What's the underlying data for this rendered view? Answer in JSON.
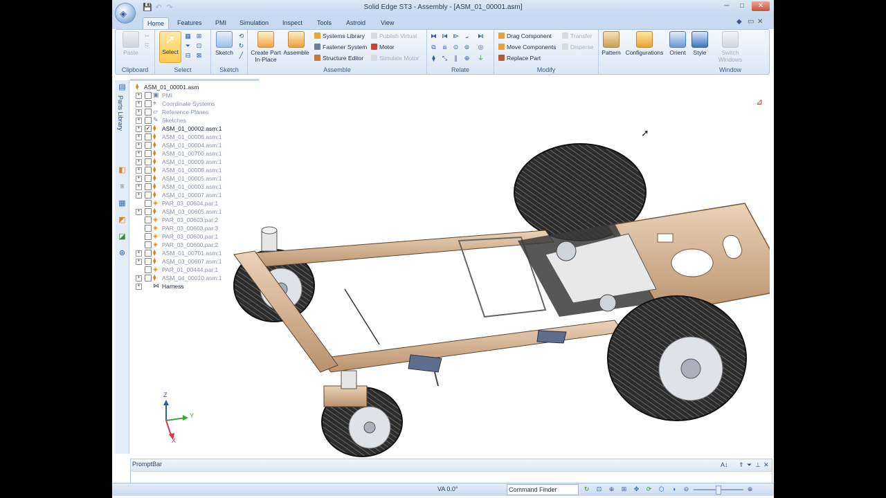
{
  "app": {
    "title": "Solid Edge ST3 - Assembly - [ASM_01_00001.asm]"
  },
  "tabs": [
    "Home",
    "Features",
    "PMI",
    "Simulation",
    "Inspect",
    "Tools",
    "Astroid",
    "View"
  ],
  "ribbon": {
    "clipboard": {
      "paste": "Paste",
      "group": "Clipboard"
    },
    "select": {
      "select": "Select",
      "group": "Select"
    },
    "sketch": {
      "sketch": "Sketch",
      "group": "Sketch"
    },
    "assemble": {
      "create_part": "Create Part In-Place",
      "create_part_l1": "Create Part",
      "create_part_l2": "In-Place",
      "assemble": "Assemble",
      "systems_library": "Systems Library",
      "publish_virtual": "Publish Virtual",
      "fastener_system": "Fastener System",
      "motor": "Motor",
      "structure_editor": "Structure Editor",
      "simulate_motor": "Simulate Motor",
      "group": "Assemble"
    },
    "relate": {
      "group": "Relate"
    },
    "modify": {
      "drag_component": "Drag Component",
      "transfer": "Transfer",
      "move_components": "Move Components",
      "disperse": "Disperse",
      "replace_part": "Replace Part",
      "group": "Modify"
    },
    "pattern": "Pattern",
    "configurations": "Configurations",
    "orient": "Orient",
    "style": "Style",
    "switch_windows_l1": "Switch",
    "switch_windows_l2": "Windows",
    "window_group": "Window"
  },
  "left_toolbar": {
    "parts_library": "Parts Library"
  },
  "tree": {
    "root": "ASM_01_00001.asm",
    "items": [
      {
        "label": "PMI",
        "type": "pmi",
        "expand": true,
        "checked": false,
        "dim": true
      },
      {
        "label": "Coordinate Systems",
        "type": "coord",
        "expand": true,
        "checked": false,
        "dim": true
      },
      {
        "label": "Reference Planes",
        "type": "planes",
        "expand": true,
        "checked": false,
        "dim": true
      },
      {
        "label": "Sketches",
        "type": "sketch",
        "expand": true,
        "checked": false,
        "dim": true
      },
      {
        "label": "ASM_01_00002.asm:1",
        "type": "asm",
        "expand": true,
        "checked": true,
        "dim": false
      },
      {
        "label": "ASM_01_00006.asm:1",
        "type": "asm",
        "expand": true,
        "checked": false,
        "dim": true
      },
      {
        "label": "ASM_01_00004.asm:1",
        "type": "asm",
        "expand": true,
        "checked": false,
        "dim": true
      },
      {
        "label": "ASM_01_00700.asm:1",
        "type": "asm",
        "expand": true,
        "checked": false,
        "dim": true
      },
      {
        "label": "ASM_01_00009.asm:1",
        "type": "asm",
        "expand": true,
        "checked": false,
        "dim": true
      },
      {
        "label": "ASM_01_00008.asm:1",
        "type": "asm",
        "expand": true,
        "checked": false,
        "dim": true
      },
      {
        "label": "ASM_01_00005.asm:1",
        "type": "asm",
        "expand": true,
        "checked": false,
        "dim": true
      },
      {
        "label": "ASM_01_00003.asm:1",
        "type": "asm",
        "expand": true,
        "checked": false,
        "dim": true
      },
      {
        "label": "ASM_01_00007.asm:1",
        "type": "asm",
        "expand": true,
        "checked": false,
        "dim": true
      },
      {
        "label": "PAR_03_00604.par:1",
        "type": "par",
        "expand": false,
        "checked": false,
        "dim": true
      },
      {
        "label": "ASM_03_00605.asm:1",
        "type": "asm",
        "expand": true,
        "checked": false,
        "dim": true
      },
      {
        "label": "PAR_03_00603.par:2",
        "type": "par",
        "expand": false,
        "checked": false,
        "dim": true
      },
      {
        "label": "PAR_03_00603.par:3",
        "type": "par",
        "expand": false,
        "checked": false,
        "dim": true
      },
      {
        "label": "PAR_03_00600.par:1",
        "type": "par",
        "expand": false,
        "checked": false,
        "dim": true
      },
      {
        "label": "PAR_03_00600.par:2",
        "type": "par",
        "expand": false,
        "checked": false,
        "dim": true
      },
      {
        "label": "ASM_01_00701.asm:1",
        "type": "asm",
        "expand": true,
        "checked": false,
        "dim": true
      },
      {
        "label": "ASM_03_00607.asm:1",
        "type": "asm",
        "expand": true,
        "checked": false,
        "dim": true
      },
      {
        "label": "PAR_01_00444.par:1",
        "type": "par",
        "expand": false,
        "checked": false,
        "dim": true
      },
      {
        "label": "ASM_04_00010.asm:1",
        "type": "asm",
        "expand": true,
        "checked": false,
        "dim": true
      },
      {
        "label": "Harness",
        "type": "harness",
        "expand": true,
        "checked": null,
        "dim": false
      }
    ]
  },
  "triad": {
    "z": "Z",
    "y": "Y",
    "x": "X"
  },
  "promptbar": {
    "title": "PromptBar"
  },
  "statusbar": {
    "va": "VA 0.0°",
    "command_finder": "Command Finder"
  },
  "colors": {
    "accent": "#2b5ba8",
    "frame": "#d9b89a",
    "tire": "#2b2b2b",
    "rim": "#d8dde3"
  }
}
